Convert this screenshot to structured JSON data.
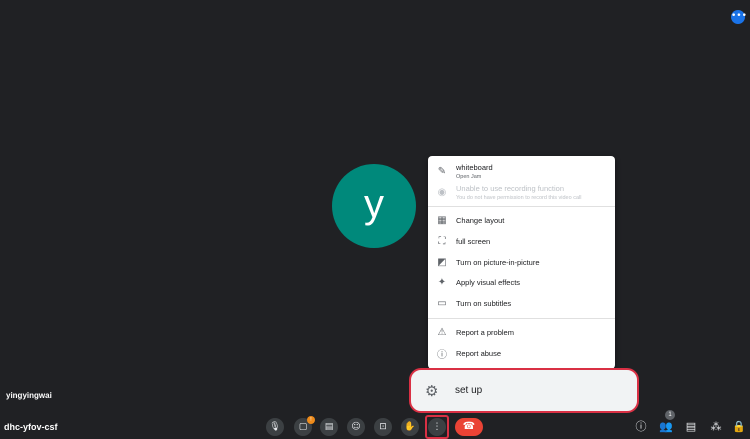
{
  "top_indicator": {
    "icon": "more-horiz-icon",
    "glyph": "•••"
  },
  "participant": {
    "initial": "y",
    "avatar_color": "#00897b",
    "name": "yingyingwai"
  },
  "meeting_code": "dhc-yfov-csf",
  "menu": {
    "whiteboard": {
      "icon": "pen-icon",
      "glyph": "✎",
      "label": "whiteboard",
      "sublabel": "Open Jam"
    },
    "recording": {
      "icon": "record-icon",
      "glyph": "◉",
      "label": "Unable to use recording function",
      "sublabel": "You do not have permission to record this video call"
    },
    "change_layout": {
      "icon": "layout-icon",
      "glyph": "▦",
      "label": "Change layout"
    },
    "full_screen": {
      "icon": "fullscreen-icon",
      "glyph": "⛶",
      "label": "full screen"
    },
    "pip": {
      "icon": "picture-in-picture-icon",
      "glyph": "◩",
      "label": "Turn on picture-in-picture"
    },
    "visual_effects": {
      "icon": "sparkle-icon",
      "glyph": "✦",
      "label": "Apply visual effects"
    },
    "subtitles": {
      "icon": "closed-caption-icon",
      "glyph": "▭",
      "label": "Turn on subtitles"
    },
    "report_problem": {
      "icon": "feedback-icon",
      "glyph": "⚠",
      "label": "Report a problem"
    },
    "report_abuse": {
      "icon": "info-icon",
      "glyph": "ⓘ",
      "label": "Report abuse"
    }
  },
  "setup": {
    "icon": "gear-icon",
    "glyph": "⚙",
    "label": "set up"
  },
  "toolbar": {
    "mic": {
      "icon": "mic-icon",
      "glyph": "🎙"
    },
    "camera": {
      "icon": "camera-icon",
      "glyph": "▢",
      "badge": "!"
    },
    "captions": {
      "icon": "captions-icon",
      "glyph": "▤"
    },
    "emoji": {
      "icon": "emoji-icon",
      "glyph": "☺"
    },
    "present": {
      "icon": "present-icon",
      "glyph": "⊡"
    },
    "raise_hand": {
      "icon": "hand-icon",
      "glyph": "✋"
    },
    "more": {
      "icon": "more-vert-icon",
      "glyph": "⋮"
    },
    "end_call": {
      "icon": "end-call-icon",
      "glyph": "☎"
    }
  },
  "right_toolbar": {
    "info": {
      "icon": "info-icon",
      "glyph": "ⓘ"
    },
    "people": {
      "icon": "people-icon",
      "glyph": "👥",
      "count": "1"
    },
    "chat": {
      "icon": "chat-icon",
      "glyph": "▤"
    },
    "activities": {
      "icon": "shapes-icon",
      "glyph": "⁂"
    },
    "host_controls": {
      "icon": "lock-person-icon",
      "glyph": "🔒"
    }
  },
  "colors": {
    "background": "#202124",
    "accent": "#1a73e8",
    "end_call": "#ea4335",
    "highlight": "#d93044"
  }
}
